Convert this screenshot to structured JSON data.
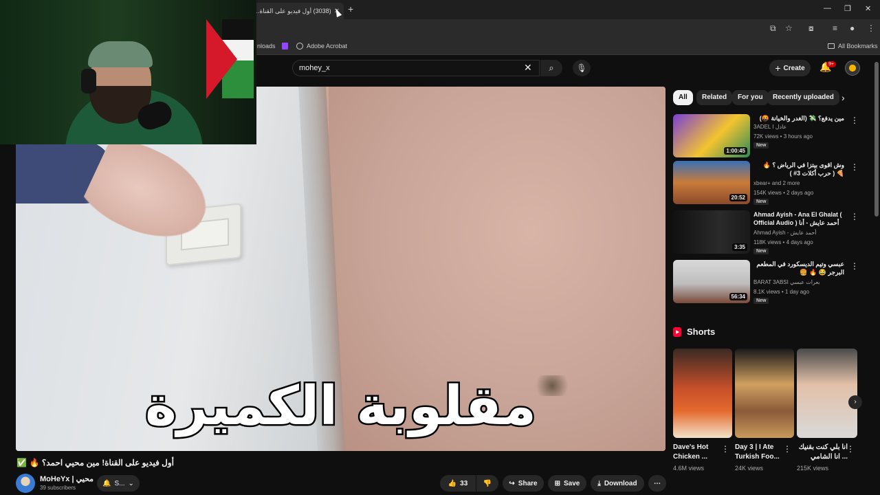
{
  "browser": {
    "tab_title": "(3038) أول فيديو على القناة! مين",
    "tab_close": "✕",
    "new_tab": "+",
    "window_controls": [
      "—",
      "❐",
      "✕"
    ],
    "bookmarks": [
      {
        "label": "nloads",
        "icon": "folder-icon"
      },
      {
        "label": "",
        "icon": "twitch-icon"
      },
      {
        "label": "Adobe Acrobat",
        "icon": "acrobat-icon"
      }
    ],
    "all_bookmarks": "All Bookmarks"
  },
  "header": {
    "search_value": "mohey_x",
    "create_label": "Create",
    "notification_count": "9+"
  },
  "video": {
    "caption": "مقلوبة الكميرة",
    "title": "أول فيديو على القناة! مين محيي احمد؟ 🔥 ✅",
    "channel_name": "MoHeYx | محيي",
    "subscribers": "39 subscribers",
    "subscribe_label": "S...",
    "likes": "33",
    "share_label": "Share",
    "save_label": "Save",
    "download_label": "Download"
  },
  "chips": [
    "All",
    "Related",
    "For you",
    "Recently uploaded"
  ],
  "related": [
    {
      "title": "مين يدفع؟ 💸 (الغدر والخيانة 🤬)",
      "channel": "3ADEL I عادل",
      "meta": "72K views • 3 hours ago",
      "duration": "1:00:45",
      "badge": "New",
      "rtl": true
    },
    {
      "title": "وش اقوى بيتزا في الرياض ؟ 🔥 🍕 ( حرب أكلات 3# )",
      "channel": "xbear+ and 2 more",
      "meta": "154K views • 2 days ago",
      "duration": "20:52",
      "badge": "New",
      "rtl": true
    },
    {
      "title": "Ahmad Ayish - Ana El Ghalat ( Official Audio ) أحمد عايش - أنا الغلط",
      "channel": "Ahmad Ayish - أحمد عايش",
      "meta": "118K views • 4 days ago",
      "duration": "3:35",
      "badge": "New",
      "rtl": false
    },
    {
      "title": "عبسي وتيم الديسكورد في المطعم البرجر 😂 🔥 🍔",
      "channel": "BARAT 3ABSI بعرات عبسي",
      "meta": "8.1K views • 1 day ago",
      "duration": "56:34",
      "badge": "New",
      "rtl": true
    }
  ],
  "shorts": {
    "heading": "Shorts",
    "items": [
      {
        "title": "Dave's Hot Chicken ...",
        "views": "4.6M views"
      },
      {
        "title": "Day 3 | I Ate Turkish Foo...",
        "views": "24K views"
      },
      {
        "title": "انا بلي كنت بقنيك ... انا الشامي",
        "views": "215K views"
      }
    ]
  },
  "colors": {
    "background": "#0f0f0f",
    "accent_red": "#ff0033",
    "chip_active": "#f1f1f1"
  }
}
